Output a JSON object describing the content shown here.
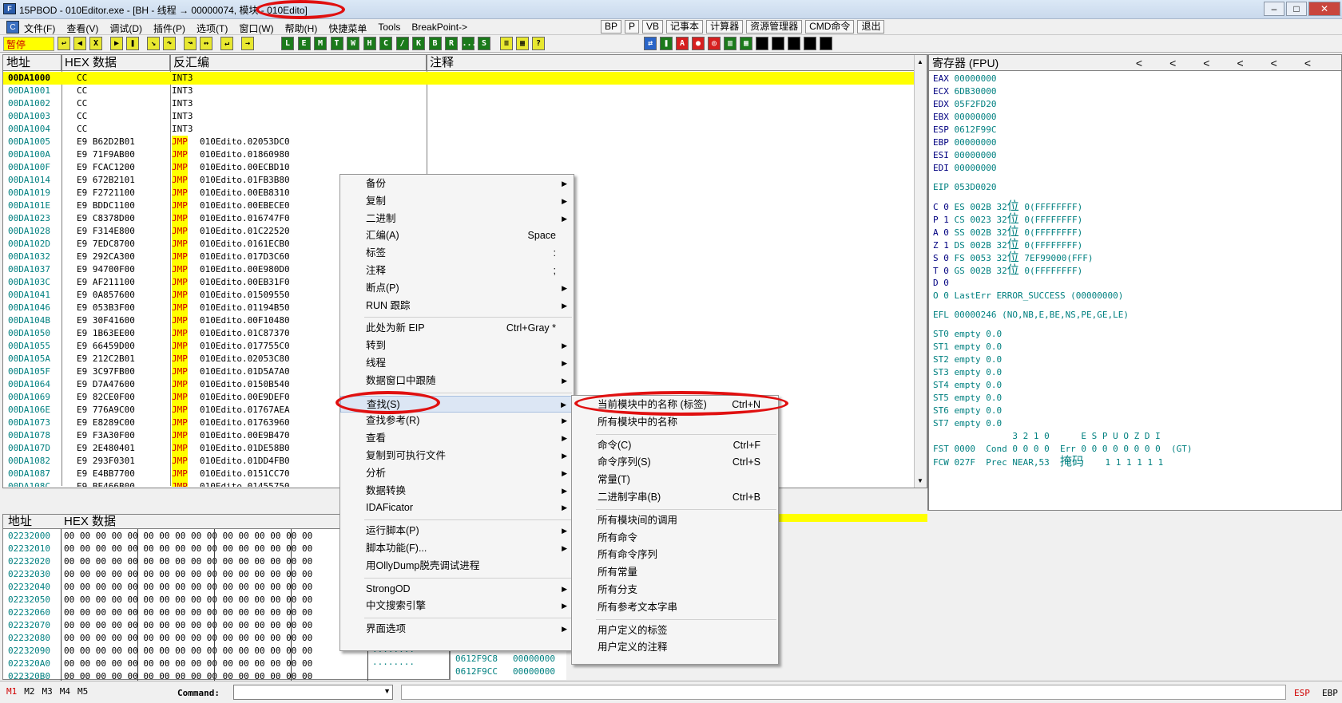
{
  "window": {
    "title": "15PBOD - 010Editor.exe - [BH - 线程 → 00000074, 模块 - 010Edito]",
    "icon": "app-icon"
  },
  "menubar": {
    "items": [
      "文件(F)",
      "查看(V)",
      "调试(D)",
      "插件(P)",
      "选项(T)",
      "窗口(W)",
      "帮助(H)",
      "快捷菜单",
      "Tools",
      "BreakPoint->"
    ],
    "quick": [
      "BP",
      "P",
      "VB",
      "记事本",
      "计算器",
      "资源管理器",
      "CMD命令",
      "退出"
    ]
  },
  "toolbar": {
    "status": "暂停",
    "letters": [
      "L",
      "E",
      "M",
      "T",
      "W",
      "H",
      "C",
      "/",
      "K",
      "B",
      "R",
      "...",
      "S"
    ]
  },
  "cpu": {
    "headers": {
      "addr": "地址",
      "hex": "HEX 数据",
      "disasm": "反汇编",
      "comment": "注释"
    },
    "rows": [
      {
        "addr": "00DA1000",
        "hex": "CC",
        "op": "INT3",
        "arg": ""
      },
      {
        "addr": "00DA1001",
        "hex": "CC",
        "op": "INT3",
        "arg": ""
      },
      {
        "addr": "00DA1002",
        "hex": "CC",
        "op": "INT3",
        "arg": ""
      },
      {
        "addr": "00DA1003",
        "hex": "CC",
        "op": "INT3",
        "arg": ""
      },
      {
        "addr": "00DA1004",
        "hex": "CC",
        "op": "INT3",
        "arg": ""
      },
      {
        "addr": "00DA1005",
        "hex": "E9 B62D2B01",
        "op": "JMP",
        "arg": "010Edito.02053DC0"
      },
      {
        "addr": "00DA100A",
        "hex": "E9 71F9AB00",
        "op": "JMP",
        "arg": "010Edito.01860980"
      },
      {
        "addr": "00DA100F",
        "hex": "E9 FCAC1200",
        "op": "JMP",
        "arg": "010Edito.00ECBD10"
      },
      {
        "addr": "00DA1014",
        "hex": "E9 672B2101",
        "op": "JMP",
        "arg": "010Edito.01FB3B80"
      },
      {
        "addr": "00DA1019",
        "hex": "E9 F2721100",
        "op": "JMP",
        "arg": "010Edito.00EB8310"
      },
      {
        "addr": "00DA101E",
        "hex": "E9 BDDC1100",
        "op": "JMP",
        "arg": "010Edito.00EBECE0"
      },
      {
        "addr": "00DA1023",
        "hex": "E9 C8378D00",
        "op": "JMP",
        "arg": "010Edito.016747F0"
      },
      {
        "addr": "00DA1028",
        "hex": "E9 F314E800",
        "op": "JMP",
        "arg": "010Edito.01C22520"
      },
      {
        "addr": "00DA102D",
        "hex": "E9 7EDC8700",
        "op": "JMP",
        "arg": "010Edito.0161ECB0"
      },
      {
        "addr": "00DA1032",
        "hex": "E9 292CA300",
        "op": "JMP",
        "arg": "010Edito.017D3C60"
      },
      {
        "addr": "00DA1037",
        "hex": "E9 94700F00",
        "op": "JMP",
        "arg": "010Edito.00E980D0"
      },
      {
        "addr": "00DA103C",
        "hex": "E9 AF211100",
        "op": "JMP",
        "arg": "010Edito.00EB31F0"
      },
      {
        "addr": "00DA1041",
        "hex": "E9 0A857600",
        "op": "JMP",
        "arg": "010Edito.01509550"
      },
      {
        "addr": "00DA1046",
        "hex": "E9 053B3F00",
        "op": "JMP",
        "arg": "010Edito.01194B50"
      },
      {
        "addr": "00DA104B",
        "hex": "E9 30F41600",
        "op": "JMP",
        "arg": "010Edito.00F10480"
      },
      {
        "addr": "00DA1050",
        "hex": "E9 1B63EE00",
        "op": "JMP",
        "arg": "010Edito.01C87370"
      },
      {
        "addr": "00DA1055",
        "hex": "E9 66459D00",
        "op": "JMP",
        "arg": "010Edito.017755C0"
      },
      {
        "addr": "00DA105A",
        "hex": "E9 212C2B01",
        "op": "JMP",
        "arg": "010Edito.02053C80"
      },
      {
        "addr": "00DA105F",
        "hex": "E9 3C97FB00",
        "op": "JMP",
        "arg": "010Edito.01D5A7A0"
      },
      {
        "addr": "00DA1064",
        "hex": "E9 D7A47600",
        "op": "JMP",
        "arg": "010Edito.0150B540"
      },
      {
        "addr": "00DA1069",
        "hex": "E9 82CE0F00",
        "op": "JMP",
        "arg": "010Edito.00E9DEF0"
      },
      {
        "addr": "00DA106E",
        "hex": "E9 776A9C00",
        "op": "JMP",
        "arg": "010Edito.01767AEA"
      },
      {
        "addr": "00DA1073",
        "hex": "E9 E8289C00",
        "op": "JMP",
        "arg": "010Edito.01763960"
      },
      {
        "addr": "00DA1078",
        "hex": "E9 F3A30F00",
        "op": "JMP",
        "arg": "010Edito.00E9B470"
      },
      {
        "addr": "00DA107D",
        "hex": "E9 2E480401",
        "op": "JMP",
        "arg": "010Edito.01DE58B0"
      },
      {
        "addr": "00DA1082",
        "hex": "E9 293F0301",
        "op": "JMP",
        "arg": "010Edito.01DD4FB0"
      },
      {
        "addr": "00DA1087",
        "hex": "E9 E4BB7700",
        "op": "JMP",
        "arg": "010Edito.0151CC70"
      },
      {
        "addr": "00DA108C",
        "hex": "E9 BE466B00",
        "op": "JMP",
        "arg": "010Edito.01455750"
      }
    ]
  },
  "registers": {
    "title": "寄存器 (FPU)",
    "nav": [
      "<",
      "<",
      "<",
      "<",
      "<",
      "<"
    ],
    "gp": [
      {
        "name": "EAX",
        "value": "00000000"
      },
      {
        "name": "ECX",
        "value": "6DB30000"
      },
      {
        "name": "EDX",
        "value": "05F2FD20"
      },
      {
        "name": "EBX",
        "value": "00000000"
      },
      {
        "name": "ESP",
        "value": "0612F99C"
      },
      {
        "name": "EBP",
        "value": "00000000"
      },
      {
        "name": "ESI",
        "value": "00000000"
      },
      {
        "name": "EDI",
        "value": "00000000"
      }
    ],
    "eip": "EIP 053D0020",
    "seg": [
      {
        "flag": "C 0",
        "text": "ES 002B 32",
        "cn": "位",
        "rest": " 0(FFFFFFFF)"
      },
      {
        "flag": "P 1",
        "text": "CS 0023 32",
        "cn": "位",
        "rest": " 0(FFFFFFFF)"
      },
      {
        "flag": "A 0",
        "text": "SS 002B 32",
        "cn": "位",
        "rest": " 0(FFFFFFFF)"
      },
      {
        "flag": "Z 1",
        "text": "DS 002B 32",
        "cn": "位",
        "rest": " 0(FFFFFFFF)"
      },
      {
        "flag": "S 0",
        "text": "FS 0053 32",
        "cn": "位",
        "rest": " 7EF99000(FFF)"
      },
      {
        "flag": "T 0",
        "text": "GS 002B 32",
        "cn": "位",
        "rest": " 0(FFFFFFFF)"
      }
    ],
    "d_flag": "D 0",
    "o_line": "O 0  LastErr ERROR_SUCCESS (00000000)",
    "efl": "EFL 00000246 (NO,NB,E,BE,NS,PE,GE,LE)",
    "fpu": [
      "ST0 empty 0.0",
      "ST1 empty 0.0",
      "ST2 empty 0.0",
      "ST3 empty 0.0",
      "ST4 empty 0.0",
      "ST5 empty 0.0",
      "ST6 empty 0.0",
      "ST7 empty 0.0"
    ],
    "fst_hdr": "               3 2 1 0      E S P U O Z D I",
    "fst": "FST 0000  Cond 0 0 0 0  Err 0 0 0 0 0 0 0 0  (GT)",
    "fcw": "FCW 027F  Prec NEAR,53  ",
    "fcw_cn": "掩码",
    "fcw_rest": "    1 1 1 1 1 1"
  },
  "dump": {
    "headers": {
      "addr": "地址",
      "hex": "HEX 数据"
    },
    "rows": [
      {
        "addr": "02232000",
        "hex": "00 00 00 00 00 00 00 00 00 00 00 00 00 00 00 00"
      },
      {
        "addr": "02232010",
        "hex": "00 00 00 00 00 00 00 00 00 00 00 00 00 00 00 00"
      },
      {
        "addr": "02232020",
        "hex": "00 00 00 00 00 00 00 00 00 00 00 00 00 00 00 00"
      },
      {
        "addr": "02232030",
        "hex": "00 00 00 00 00 00 00 00 00 00 00 00 00 00 00 00"
      },
      {
        "addr": "02232040",
        "hex": "00 00 00 00 00 00 00 00 00 00 00 00 00 00 00 00"
      },
      {
        "addr": "02232050",
        "hex": "00 00 00 00 00 00 00 00 00 00 00 00 00 00 00 00"
      },
      {
        "addr": "02232060",
        "hex": "00 00 00 00 00 00 00 00 00 00 00 00 00 00 00 00"
      },
      {
        "addr": "02232070",
        "hex": "00 00 00 00 00 00 00 00 00 00 00 00 00 00 00 00"
      },
      {
        "addr": "02232080",
        "hex": "00 00 00 00 00 00 00 00 00 00 00 00 00 00 00 00"
      },
      {
        "addr": "02232090",
        "hex": "00 00 00 00 00 00 00 00 00 00 00 00 00 00 00 00"
      },
      {
        "addr": "022320A0",
        "hex": "00 00 00 00 00 00 00 00 00 00 00 00 00 00 00 00"
      },
      {
        "addr": "022320B0",
        "hex": "00 00 00 00 00 00 00 00 00 00 00 00 00 00 00 00"
      }
    ],
    "ascii": "........"
  },
  "stack": {
    "rows": [
      {
        "addr": "0612F9C8",
        "val": "00000000"
      },
      {
        "addr": "0612F9CC",
        "val": "00000000"
      }
    ]
  },
  "status": {
    "tabs": [
      "M1",
      "M2",
      "M3",
      "M4",
      "M5"
    ],
    "command_label": "Command:",
    "esp": "ESP",
    "ebp": "EBP"
  },
  "context_menu": {
    "items": [
      {
        "label": "备份",
        "arrow": true
      },
      {
        "label": "复制",
        "arrow": true
      },
      {
        "label": "二进制",
        "arrow": true
      },
      {
        "label": "汇编(A)",
        "shortcut": "Space"
      },
      {
        "label": "标签",
        "shortcut": ":"
      },
      {
        "label": "注释",
        "shortcut": ";"
      },
      {
        "label": "断点(P)",
        "arrow": true
      },
      {
        "label": "RUN 跟踪",
        "arrow": true
      },
      {
        "sep": true
      },
      {
        "label": "此处为新 EIP",
        "shortcut": "Ctrl+Gray *"
      },
      {
        "label": "转到",
        "arrow": true
      },
      {
        "label": "线程",
        "arrow": true
      },
      {
        "label": "数据窗口中跟随",
        "arrow": true
      },
      {
        "sep": true
      },
      {
        "label": "查找(S)",
        "arrow": true,
        "active": true
      },
      {
        "label": "查找参考(R)",
        "arrow": true
      },
      {
        "label": "查看",
        "arrow": true
      },
      {
        "label": "复制到可执行文件",
        "arrow": true
      },
      {
        "label": "分析",
        "arrow": true
      },
      {
        "label": "数据转换",
        "arrow": true
      },
      {
        "label": "IDAFicator",
        "arrow": true
      },
      {
        "sep": true
      },
      {
        "label": "运行脚本(P)",
        "arrow": true
      },
      {
        "label": "脚本功能(F)...",
        "arrow": true
      },
      {
        "label": "用OllyDump脱壳调试进程"
      },
      {
        "sep": true
      },
      {
        "label": "StrongOD",
        "arrow": true
      },
      {
        "label": "中文搜索引擎",
        "arrow": true
      },
      {
        "sep": true
      },
      {
        "label": "界面选项",
        "arrow": true
      }
    ]
  },
  "submenu": {
    "items": [
      {
        "label": "当前模块中的名称 (标签)",
        "shortcut": "Ctrl+N"
      },
      {
        "label": "所有模块中的名称"
      },
      {
        "sep": true
      },
      {
        "label": "命令(C)",
        "shortcut": "Ctrl+F"
      },
      {
        "label": "命令序列(S)",
        "shortcut": "Ctrl+S"
      },
      {
        "label": "常量(T)"
      },
      {
        "label": "二进制字串(B)",
        "shortcut": "Ctrl+B"
      },
      {
        "sep": true
      },
      {
        "label": "所有模块间的调用"
      },
      {
        "label": "所有命令"
      },
      {
        "label": "所有命令序列"
      },
      {
        "label": "所有常量"
      },
      {
        "label": "所有分支"
      },
      {
        "label": "所有参考文本字串"
      },
      {
        "sep": true
      },
      {
        "label": "用户定义的标签"
      },
      {
        "label": "用户定义的注释"
      }
    ]
  },
  "colors": {
    "selection": "#ffff00",
    "jmp": "#d00000",
    "address": "#008080",
    "annotation": "#e01010"
  }
}
